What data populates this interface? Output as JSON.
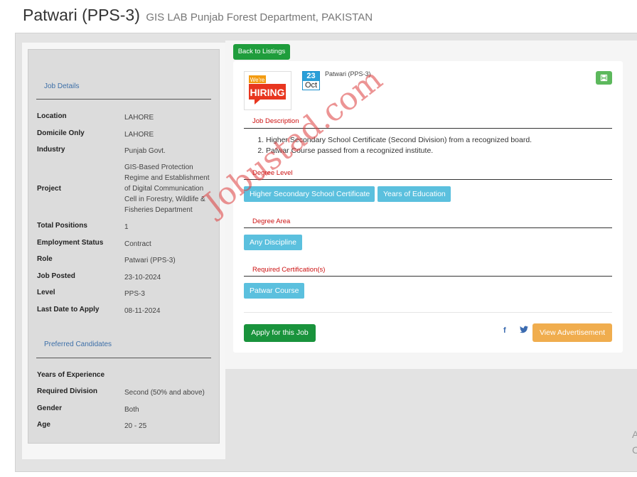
{
  "header": {
    "title": "Patwari (PPS-3)",
    "subtitle": "GIS LAB Punjab Forest Department, PAKISTAN"
  },
  "sidebar": {
    "job_details_heading": "Job Details",
    "details": [
      {
        "label": "Location",
        "value": "LAHORE"
      },
      {
        "label": "Domicile Only",
        "value": "LAHORE"
      },
      {
        "label": "Industry",
        "value": "Punjab Govt."
      },
      {
        "label": "Project",
        "value": "GIS-Based Protection Regime and Establishment of Digital Communication Cell in Forestry, Wildlife & Fisheries Department"
      },
      {
        "label": "Total Positions",
        "value": "1"
      },
      {
        "label": "Employment Status",
        "value": "Contract"
      },
      {
        "label": "Role",
        "value": "Patwari (PPS-3)"
      },
      {
        "label": "Job Posted",
        "value": "23-10-2024"
      },
      {
        "label": "Level",
        "value": "PPS-3"
      },
      {
        "label": "Last Date to Apply",
        "value": "08-11-2024"
      }
    ],
    "preferred_heading": "Preferred Candidates",
    "preferred": [
      {
        "label": "Years of Experience",
        "value": ""
      },
      {
        "label": "Required Division",
        "value": "Second (50% and above)"
      },
      {
        "label": "Gender",
        "value": "Both"
      },
      {
        "label": "Age",
        "value": "20 - 25"
      }
    ]
  },
  "main": {
    "back_label": "Back to Listings",
    "logo": {
      "line1": "We're",
      "line2": "HIRING"
    },
    "date": {
      "day": "23",
      "month": "Oct"
    },
    "job_title": "Patwari (PPS-3)",
    "save_icon": "save-icon",
    "job_description_heading": "Job Description",
    "requirements": [
      "Higher Secondary School Certificate (Second Division) from a recognized board.",
      "Patwar Course passed from a recognized institute."
    ],
    "degree_level_heading": "Degree Level",
    "degree_levels": [
      "Higher Secondary School Certificate",
      "Years of Education"
    ],
    "degree_area_heading": "Degree Area",
    "degree_areas": [
      "Any Discipline"
    ],
    "certifications_heading": "Required Certification(s)",
    "certifications": [
      "Patwar Course"
    ],
    "apply_label": "Apply for this Job",
    "social": {
      "facebook": "f",
      "twitter_icon": "twitter-icon"
    },
    "view_ad_label": "View Advertisement"
  },
  "watermark": "Jobustad.com",
  "edge_chars": [
    "A",
    "C"
  ],
  "colors": {
    "primary_green": "#1f9d3c",
    "tag_blue": "#5bc0de",
    "heading_red": "#cc1111",
    "heading_blue": "#3d6fa8",
    "view_orange": "#f0ad4e"
  }
}
